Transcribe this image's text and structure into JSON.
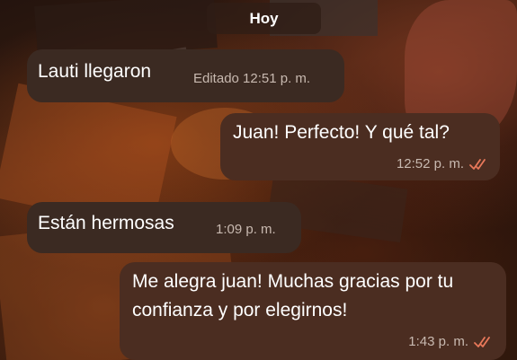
{
  "date_separator": "Hoy",
  "messages": [
    {
      "direction": "in",
      "text": "Lauti llegaron",
      "meta": "Editado 12:51 p. m."
    },
    {
      "direction": "out",
      "text": "Juan! Perfecto! Y qué tal?",
      "meta": "12:52 p. m.",
      "status_icon": "double-check-icon"
    },
    {
      "direction": "in",
      "text": "Están hermosas",
      "meta": "1:09 p. m."
    },
    {
      "direction": "out",
      "text": "Me alegra juan! Muchas gracias por tu confianza y por elegirnos!",
      "meta": "1:43 p. m.",
      "status_icon": "double-check-icon"
    }
  ],
  "colors": {
    "outgoing_bubble": "#4b2d21",
    "incoming_bubble": "#3b2a22",
    "read_check": "#e8785a"
  }
}
